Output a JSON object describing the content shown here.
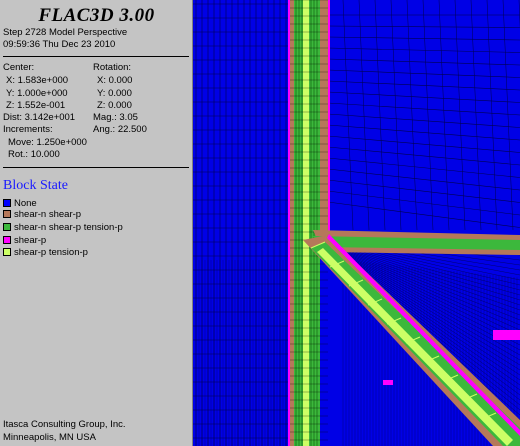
{
  "app": {
    "title": "FLAC3D 3.00"
  },
  "header": {
    "step_line": "Step 2728  Model Perspective",
    "time_line": "09:59:36 Thu Dec 23 2010"
  },
  "view_params": {
    "center_label": "Center:",
    "center_x": "X: 1.583e+000",
    "center_y": "Y: 1.000e+000",
    "center_z": "Z: 1.552e-001",
    "rotation_label": "Rotation:",
    "rot_x": "X:  0.000",
    "rot_y": "Y:  0.000",
    "rot_z": "Z:  0.000",
    "dist": "Dist: 3.142e+001",
    "mag": "Mag.:    3.05",
    "ang": "Ang.:  22.500",
    "increments_label": "Increments:",
    "move": "Move: 1.250e+000",
    "rot": "Rot.:  10.000"
  },
  "legend": {
    "title": "Block State",
    "items": [
      {
        "label": "None",
        "color": "#0000ff"
      },
      {
        "label": "shear-n shear-p",
        "color": "#b5785a"
      },
      {
        "label": "shear-n shear-p tension-p",
        "color": "#3cb83c"
      },
      {
        "label": "shear-p",
        "color": "#ff00ff"
      },
      {
        "label": "shear-p tension-p",
        "color": "#ccff66"
      }
    ]
  },
  "footer": {
    "company": "Itasca Consulting Group, Inc.",
    "location": "Minneapolis, MN  USA"
  }
}
